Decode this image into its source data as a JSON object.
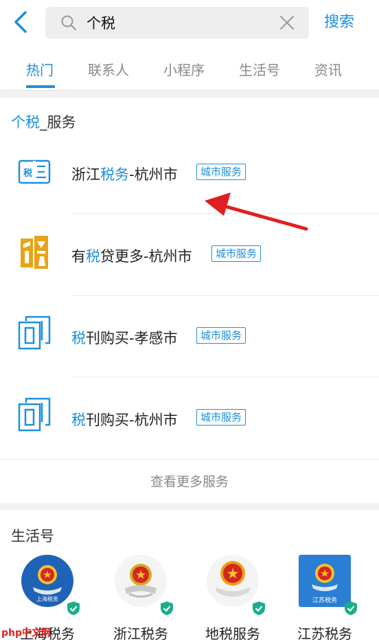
{
  "header": {
    "back_label": "",
    "search_value": "个税",
    "search_button": "搜索"
  },
  "tabs": [
    {
      "label": "热门",
      "active": true
    },
    {
      "label": "联系人",
      "active": false
    },
    {
      "label": "小程序",
      "active": false
    },
    {
      "label": "生活号",
      "active": false
    },
    {
      "label": "资讯",
      "active": false
    }
  ],
  "services": {
    "title_keyword": "个税",
    "title_rest": "_服务",
    "items": [
      {
        "pre": "浙江",
        "hl": "税务",
        "post": "-杭州市",
        "tag": "城市服务",
        "icon": "tax-three-icon"
      },
      {
        "pre": "有",
        "hl": "税",
        "post": "贷更多-杭州市",
        "tag": "城市服务",
        "icon": "tax-loan-icon"
      },
      {
        "pre": "",
        "hl": "税",
        "post": "刊购买-孝感市",
        "tag": "城市服务",
        "icon": "document-copy-icon"
      },
      {
        "pre": "",
        "hl": "税",
        "post": "刊购买-杭州市",
        "tag": "城市服务",
        "icon": "document-copy-icon"
      }
    ],
    "more": "查看更多服务"
  },
  "life": {
    "title": "生活号",
    "items": [
      {
        "label": "上海税务",
        "logo_text": "上海税务"
      },
      {
        "label": "浙江税务",
        "logo_text": ""
      },
      {
        "label": "地税服务",
        "logo_text": ""
      },
      {
        "label": "江苏税务",
        "logo_text": "江苏税务"
      }
    ]
  },
  "colors": {
    "accent": "#1e8fdc",
    "verify": "#1aaf8b",
    "arrow": "#e02020"
  },
  "watermark": "php中文网"
}
